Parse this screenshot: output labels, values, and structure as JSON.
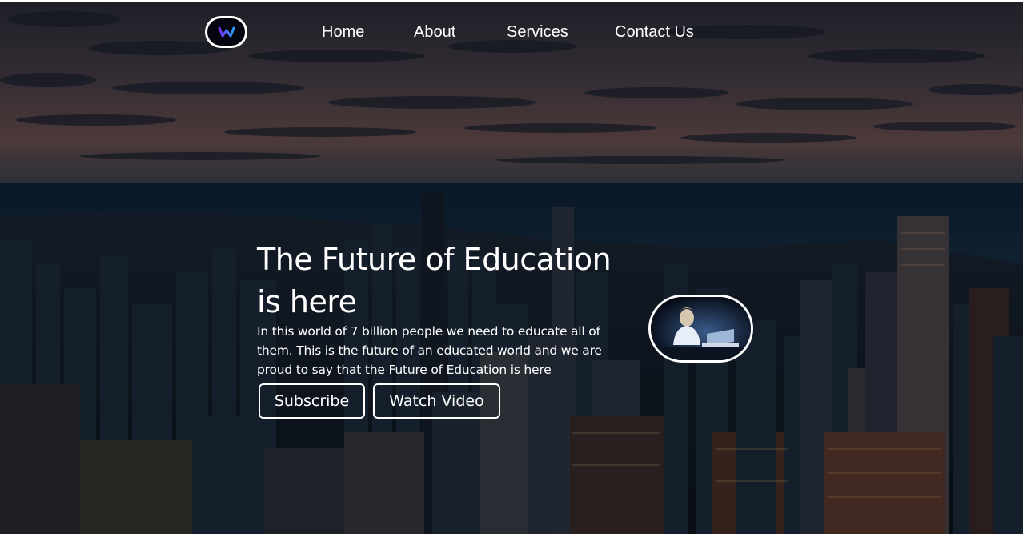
{
  "nav": {
    "logo_icon": "logo-w-icon",
    "links": [
      {
        "label": "Home"
      },
      {
        "label": "About"
      },
      {
        "label": "Services"
      },
      {
        "label": "Contact Us"
      }
    ]
  },
  "hero": {
    "title": "The Future of Education is here",
    "description": "In this world of 7 billion people we need to educate all of them. This is the future of an educated world and we are proud to say that the Future of Education is here",
    "buttons": {
      "subscribe": "Subscribe",
      "watch_video": "Watch Video"
    },
    "image_icon": "student-at-laptop-image"
  },
  "colors": {
    "text": "#ffffff",
    "logo_gradient_start": "#7b2ff7",
    "logo_gradient_end": "#1fa2ff",
    "background": "#0c1826"
  }
}
